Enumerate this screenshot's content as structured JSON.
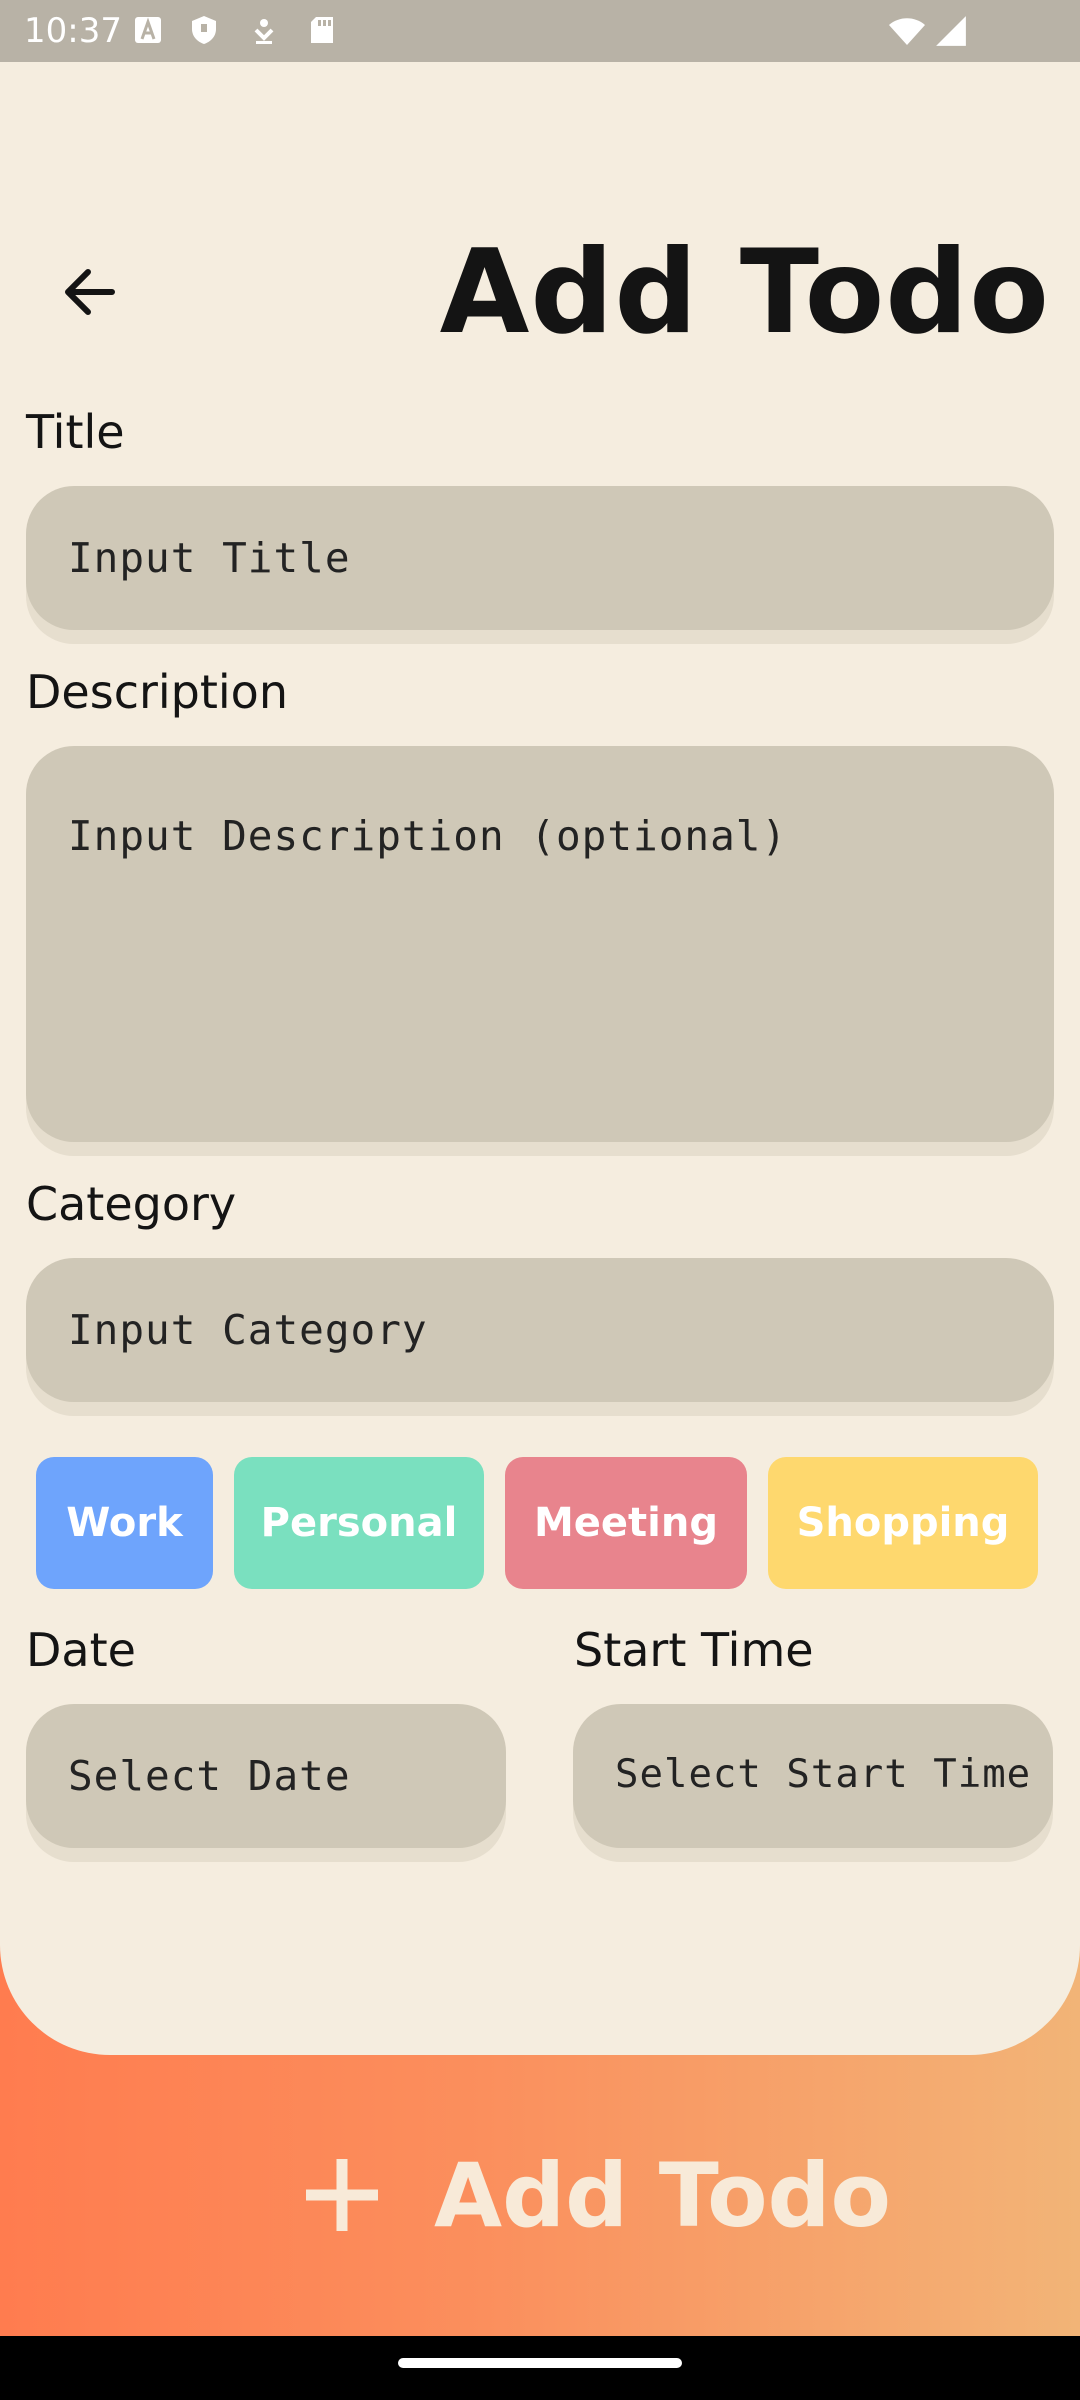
{
  "status_bar": {
    "time": "10:37"
  },
  "header": {
    "title": "Add Todo"
  },
  "form": {
    "title_label": "Title",
    "title_placeholder": "Input Title",
    "description_label": "Description",
    "description_placeholder": "Input Description (optional)",
    "category_label": "Category",
    "category_placeholder": "Input Category",
    "date_label": "Date",
    "date_placeholder": "Select Date",
    "start_time_label": "Start Time",
    "start_time_placeholder": "Select Start Time"
  },
  "category_chips": [
    {
      "label": "Work",
      "color": "#6ea4fc"
    },
    {
      "label": "Personal",
      "color": "#7ae0bf"
    },
    {
      "label": "Meeting",
      "color": "#e8848d"
    },
    {
      "label": "Shopping",
      "color": "#fed86e"
    }
  ],
  "submit": {
    "label": "Add Todo",
    "icon": "plus-icon"
  },
  "colors": {
    "background": "#f5eddf",
    "field": "#cfc8b7",
    "accent_gradient_start": "#ff7c4f",
    "accent_gradient_end": "#f2b477"
  }
}
